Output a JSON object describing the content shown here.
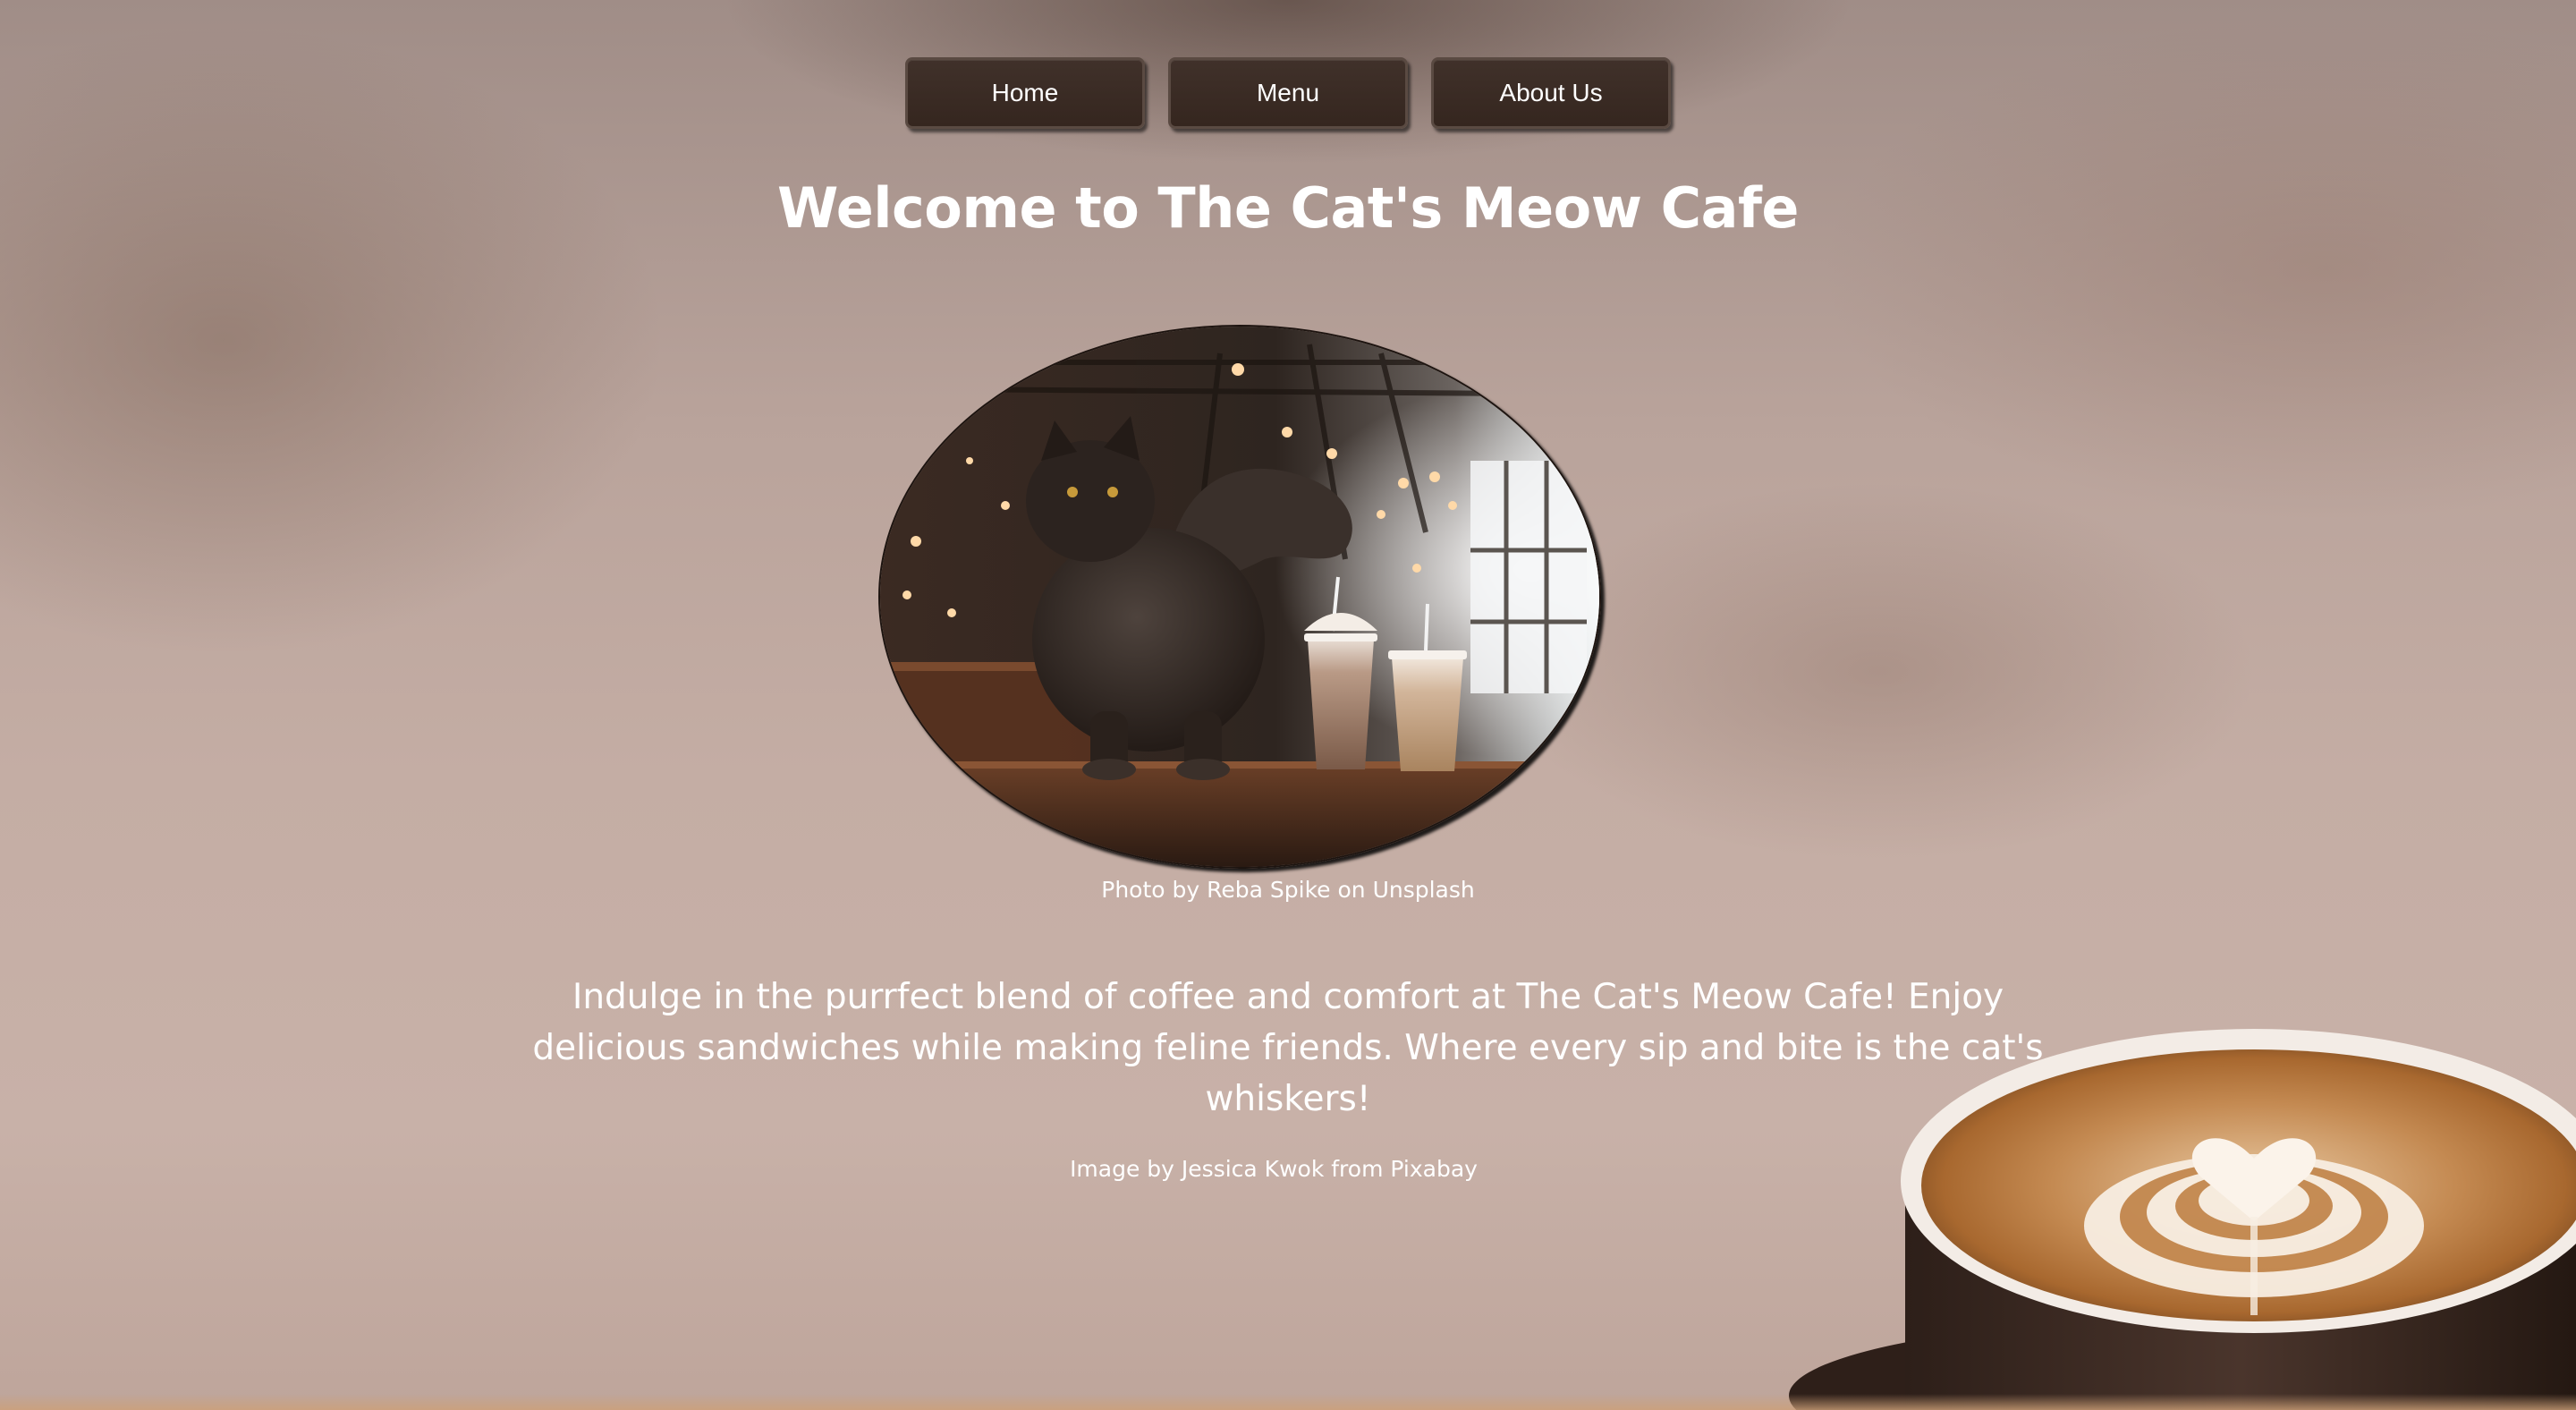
{
  "nav": {
    "items": [
      {
        "label": "Home"
      },
      {
        "label": "Menu"
      },
      {
        "label": "About Us"
      }
    ]
  },
  "hero": {
    "title": "Welcome to The Cat's Meow Cafe",
    "photo_credit": "Photo by Reba Spike on Unsplash"
  },
  "main": {
    "description": "Indulge in the purrfect blend of coffee and comfort at The Cat's Meow Cafe! Enjoy delicious sandwiches while making feline friends. Where every sip and bite is the cat's whiskers!"
  },
  "footer": {
    "image_credit": "Image by Jessica Kwok from Pixabay"
  },
  "colors": {
    "button_bg": "#3a2b24",
    "button_text": "#ffffff",
    "text": "#ffffff",
    "background": "#c4ada4"
  }
}
